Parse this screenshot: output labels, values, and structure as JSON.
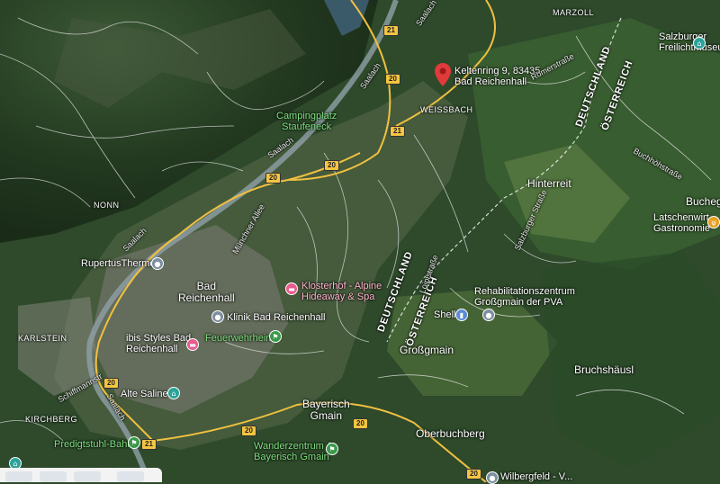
{
  "map": {
    "towns": {
      "bad_reichenhall": "Bad\nReichenhall",
      "grossgmain": "Großgmain",
      "bayerisch_gmain": "Bayerisch\nGmain",
      "oberbuchberg": "Oberbuchberg",
      "hinterreit": "Hinterreit",
      "bruchshausl": "Bruchshäusl",
      "buchegg": "Buchegg",
      "weissbach": "WEISSBACH",
      "marzoll": "MARZOLL",
      "nonn": "NONN",
      "karlstein": "KARLSTEIN",
      "kirchberg": "KIRCHBERG"
    },
    "pois": {
      "address": "Keltenring 9, 83435\nBad Reichenhall",
      "salzburger": "Salzburger\nFreilichtmuseum",
      "latschenwirt": "Latschenwirt\nGastronomie",
      "campingplatz": "Campingplatz\nStaufeneck",
      "rupertus": "RupertusTherme",
      "klosterhof": "Klosterhof - Alpine\nHideaway & Spa",
      "klinik": "Klinik Bad Reichenhall",
      "ibis": "ibis Styles Bad\nReichenhall",
      "feuerwehr": "Feuerwehrheim",
      "reha": "Rehabilitationszentrum\nGroßgmain der PVA",
      "shell": "Shell",
      "alte_saline": "Alte Saline",
      "predigtstuhl": "Predigtstuhl-Bahn",
      "wanderzentrum": "Wanderzentrum &\nBayerisch Gmain",
      "bottom_right": "Wilbergfeld - V..."
    },
    "borders": {
      "de1": "DEUTSCHLAND",
      "at1": "ÖSTERREICH",
      "de2": "DEUTSCHLAND",
      "at2": "ÖSTERREICH"
    },
    "roads": {
      "saalach1": "Saalach",
      "saalach2": "Saalach",
      "saalach3": "Saalach",
      "saalach4": "Saalach",
      "saalach5": "Saalach",
      "muenchner": "Münchner Allee",
      "roemer": "Römerstraße",
      "buchhoehe": "Buchhöhstraße",
      "salzburger_str": "Salzburger Straße",
      "loipl": "Loiplstraße",
      "schiff": "Schiffmannstr"
    },
    "shields": {
      "s1": "20",
      "s2": "21",
      "s3": "20",
      "s4": "20",
      "s5": "21",
      "s6": "20",
      "s7": "20",
      "s8": "21",
      "s9": "20",
      "s10": "20"
    }
  }
}
